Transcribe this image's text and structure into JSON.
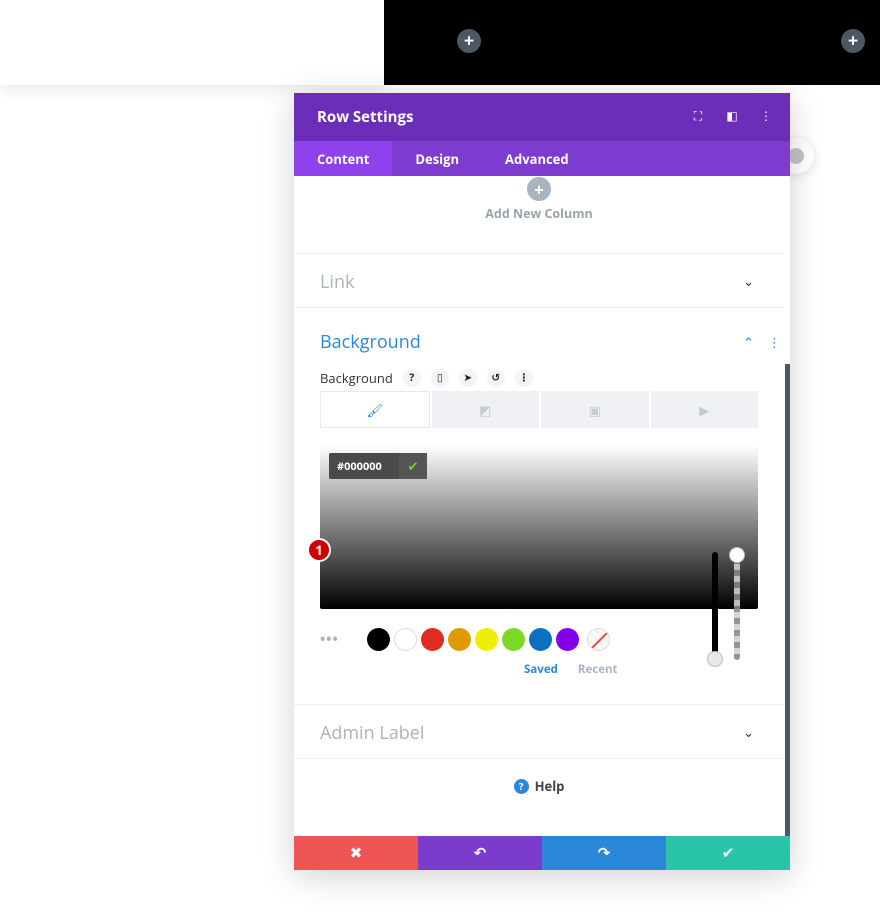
{
  "backdrop": {
    "plus_left": "+",
    "plus_right": "+"
  },
  "modal": {
    "title": "Row Settings",
    "tabs": [
      {
        "label": "Content",
        "active": true
      },
      {
        "label": "Design",
        "active": false
      },
      {
        "label": "Advanced",
        "active": false
      }
    ],
    "add_column": {
      "plus": "+",
      "label": "Add New Column"
    },
    "link_section": {
      "title": "Link"
    },
    "background_section": {
      "title": "Background",
      "field_label": "Background",
      "field_icons": [
        "help-icon",
        "mobile-icon",
        "cursor-icon",
        "reset-icon",
        "more-icon"
      ],
      "type_tabs": [
        "color-icon",
        "gradient-icon",
        "image-icon",
        "video-icon"
      ],
      "color_picker": {
        "hex_value": "#000000",
        "marker": "1",
        "more_label": "•••",
        "swatches": [
          "#000000",
          "#ffffff",
          "#e02b20",
          "#e09900",
          "#edf000",
          "#7cda24",
          "#0c71c3",
          "#8300e9"
        ],
        "saved_label": "Saved",
        "recent_label": "Recent"
      }
    },
    "admin_label_section": {
      "title": "Admin Label"
    },
    "help": {
      "label": "Help",
      "icon": "?"
    },
    "footer": {
      "cancel": "✖",
      "undo": "↶",
      "redo": "↷",
      "save": "✔"
    }
  }
}
